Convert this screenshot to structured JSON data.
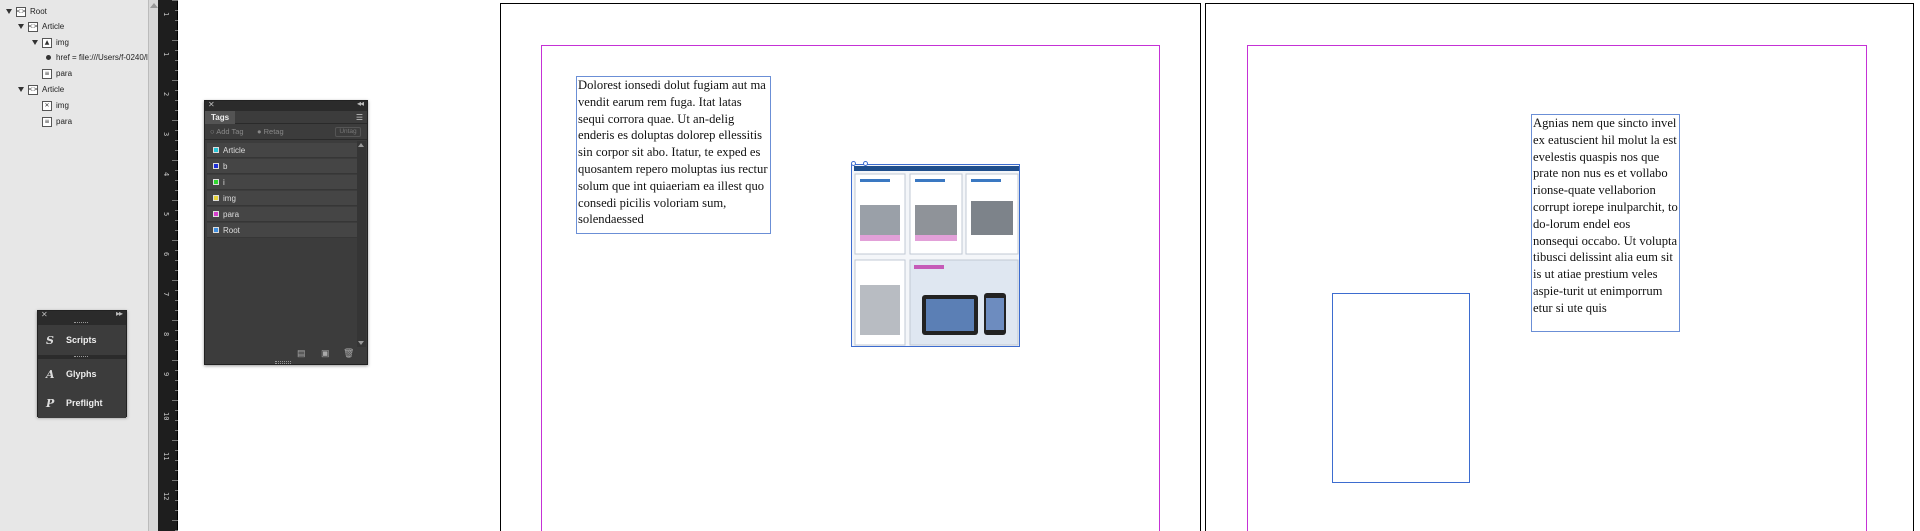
{
  "structure": {
    "items": [
      {
        "label": "Root",
        "icon": "element-icon"
      },
      {
        "label": "Article",
        "icon": "element-icon"
      },
      {
        "label": "img",
        "icon": "image-element-icon"
      },
      {
        "label": "href = file:///Users/f-0240/l",
        "icon": "attribute-dot-icon"
      },
      {
        "label": "para",
        "icon": "text-element-icon"
      },
      {
        "label": "Article",
        "icon": "element-icon"
      },
      {
        "label": "img",
        "icon": "empty-image-element-icon"
      },
      {
        "label": "para",
        "icon": "text-element-icon"
      }
    ]
  },
  "ruler": {
    "labels": [
      "1",
      "1",
      "2",
      "3",
      "4",
      "5",
      "6",
      "7",
      "8",
      "9",
      "10",
      "11",
      "12"
    ]
  },
  "tags_panel": {
    "title": "Tags",
    "add_tag": "Add Tag",
    "retag": "Retag",
    "untag": "Untag",
    "tags": [
      {
        "name": "Article",
        "color": "#27c4d6"
      },
      {
        "name": "b",
        "color": "#1f2fd6"
      },
      {
        "name": "i",
        "color": "#2fd62f"
      },
      {
        "name": "img",
        "color": "#e6d23a"
      },
      {
        "name": "para",
        "color": "#d63fcc"
      },
      {
        "name": "Root",
        "color": "#3f8fe0"
      }
    ]
  },
  "dock": {
    "scripts": "Scripts",
    "glyphs": "Glyphs",
    "preflight": "Preflight"
  },
  "document": {
    "left_text": "Dolorest ionsedi dolut fugiam aut ma vendit earum rem fuga. Itat latas sequi corrora quae. Ut an-delig enderis es doluptas dolorep ellessitis sin corpor sit abo. Itatur, te exped es quosantem repero moluptas ius rectur solum que int quiaeriam ea illest quo consedi picilis voloriam sum, solendaessed",
    "right_text": "Agnias nem que sincto invel ex eatuscient hil molut la est evelestis quaspis nos que prate non nus es et vollabo rionse-quate vellaborion corrupt iorepe inulparchit, to do-lorum endel eos nonsequi occabo. Ut volupta tibusci delissint alia eum sit is ut atiae prestium veles aspie-turit ut enimporrum etur si ute quis"
  },
  "colors": {
    "margin": "#c531d6",
    "frame": "#3d6ccf"
  }
}
